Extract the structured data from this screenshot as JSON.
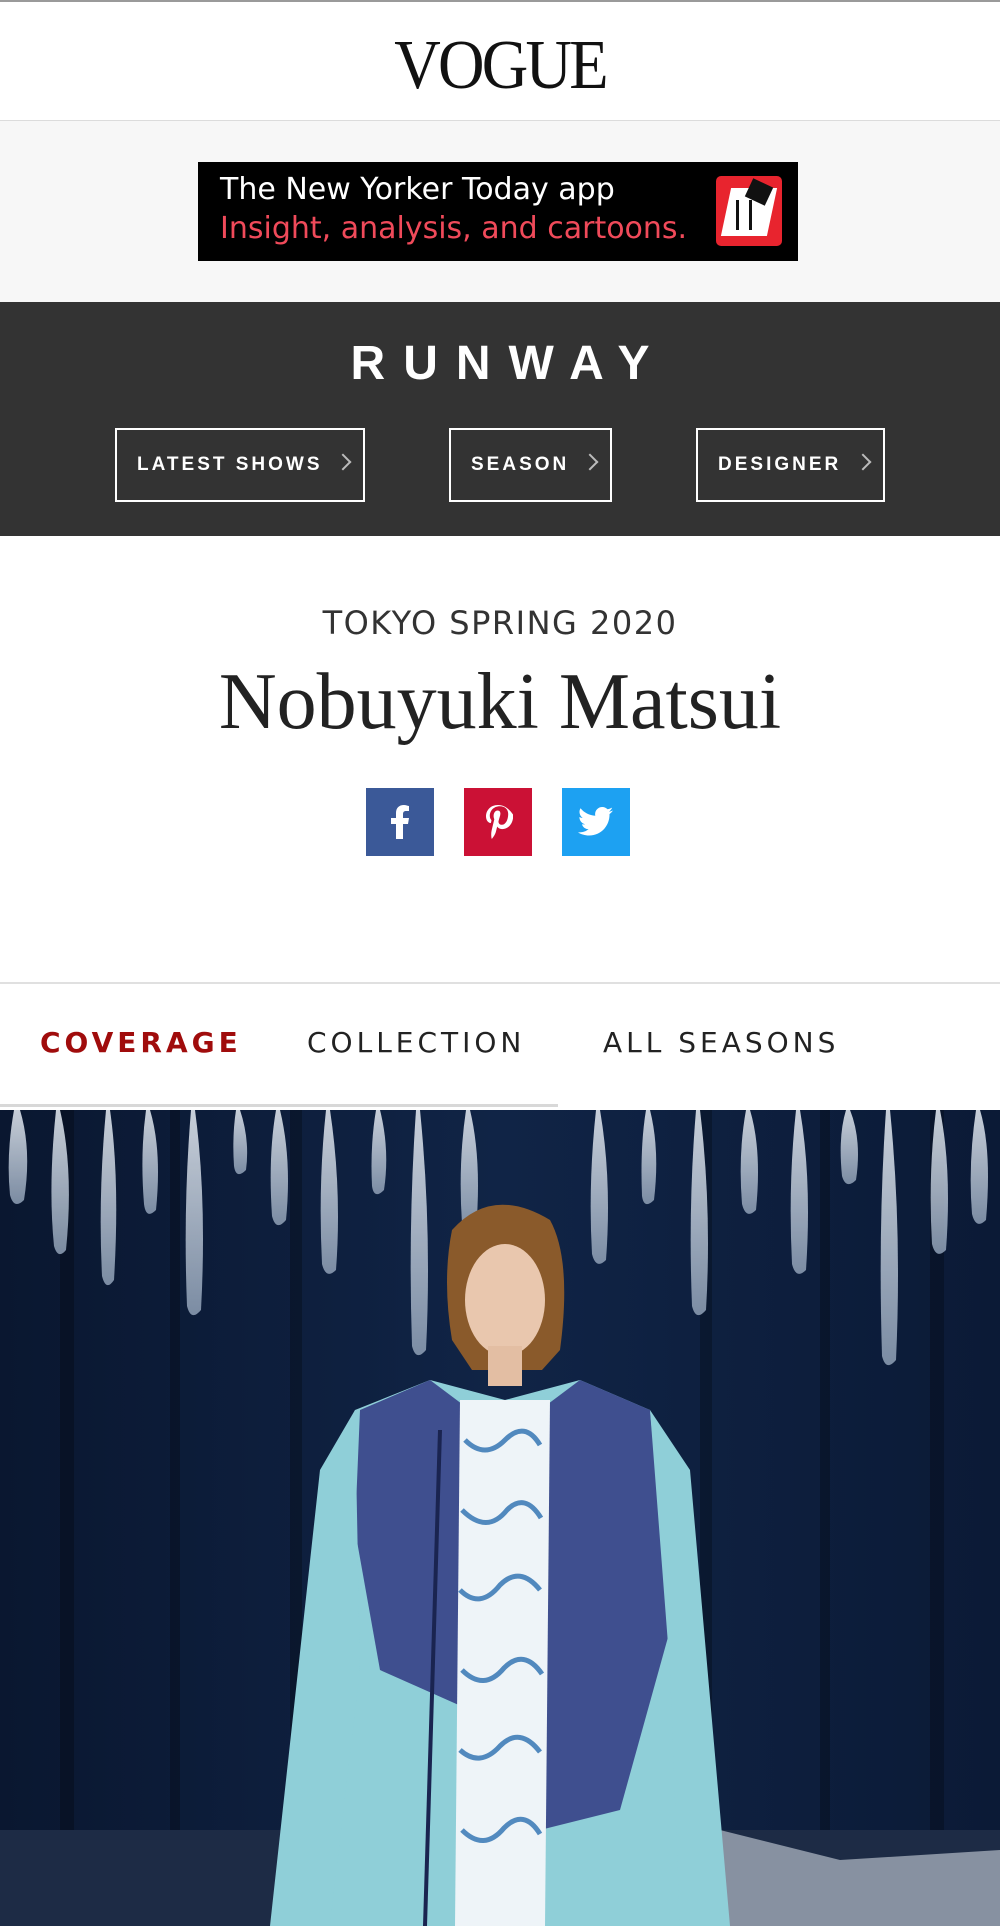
{
  "header": {
    "logo_text": "VOGUE"
  },
  "ad": {
    "line1": "The New Yorker Today app",
    "line2": "Insight, analysis, and cartoons.",
    "logo_icon": "new-yorker-app-icon",
    "colors": {
      "background": "#000000",
      "line1": "#ffffff",
      "line2": "#f04a5a",
      "badge": "#e8242e"
    }
  },
  "runway": {
    "title": "RUNWAY",
    "nav": [
      {
        "label": "LATEST SHOWS"
      },
      {
        "label": "SEASON"
      },
      {
        "label": "DESIGNER"
      }
    ],
    "background": "#333333"
  },
  "show": {
    "season": "TOKYO SPRING 2020",
    "designer": "Nobuyuki Matsui"
  },
  "share": [
    {
      "icon": "facebook-icon",
      "color": "#3b5998"
    },
    {
      "icon": "pinterest-icon",
      "color": "#cb1135"
    },
    {
      "icon": "twitter-icon",
      "color": "#1da1f2"
    }
  ],
  "tabs": [
    {
      "label": "COVERAGE",
      "active": true
    },
    {
      "label": "COLLECTION",
      "active": false
    },
    {
      "label": "ALL SEASONS",
      "active": false
    }
  ],
  "colors": {
    "active_tab": "#a00c0c"
  }
}
